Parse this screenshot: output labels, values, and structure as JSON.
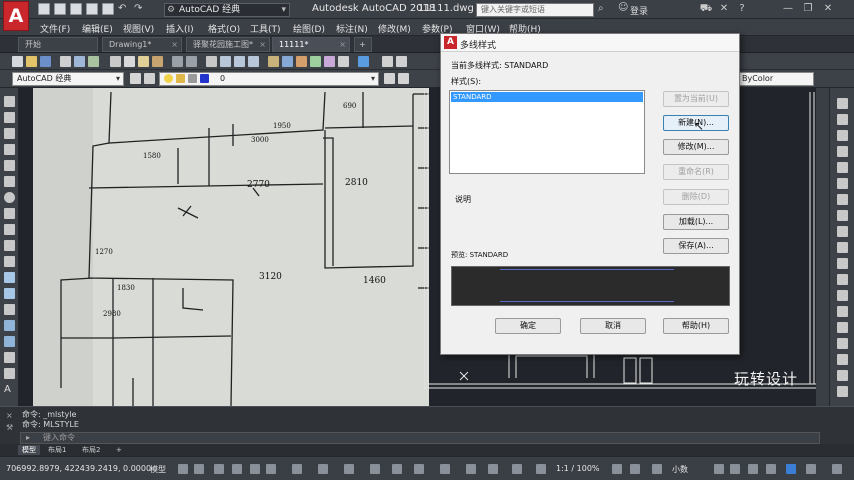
{
  "app": {
    "title": "Autodesk AutoCAD 2018",
    "document": "11111.dwg",
    "workspace": "AutoCAD 经典",
    "search_placeholder": "键入关键字或短语",
    "login": "登录",
    "logo": "A"
  },
  "menu": [
    "文件(F)",
    "编辑(E)",
    "视图(V)",
    "插入(I)",
    "格式(O)",
    "工具(T)",
    "绘图(D)",
    "标注(N)",
    "修改(M)",
    "参数(P)",
    "窗口(W)",
    "帮助(H)"
  ],
  "tabs": [
    {
      "label": "开始",
      "active": false
    },
    {
      "label": "Drawing1*",
      "active": false
    },
    {
      "label": "驿聚花园施工图*",
      "active": false
    },
    {
      "label": "11111*",
      "active": true
    }
  ],
  "toolbar2": {
    "workspace": "AutoCAD 经典",
    "layer_name": "0",
    "bylayer": "ByColor"
  },
  "dialog": {
    "title": "多线样式",
    "current_style": "当前多线样式: STANDARD",
    "styles_label": "样式(S):",
    "styles": [
      "STANDARD"
    ],
    "description_label": "说明",
    "preview_label": "预览: STANDARD",
    "buttons": {
      "set_current": "置为当前(U)",
      "new": "新建(N)...",
      "modify": "修改(M)...",
      "rename": "重命名(R)",
      "delete": "删除(D)",
      "load": "加载(L)...",
      "save": "保存(A)...",
      "ok": "确定",
      "cancel": "取消",
      "help": "帮助(H)"
    }
  },
  "watermark": "玩转设计",
  "command": {
    "history": [
      "命令: _mlstyle",
      "命令: MLSTYLE"
    ],
    "input_placeholder": "键入命令"
  },
  "layout_tabs": [
    {
      "label": "模型",
      "active": true
    },
    {
      "label": "布局1",
      "active": false
    },
    {
      "label": "布局2",
      "active": false
    }
  ],
  "status": {
    "coordinates": "706992.8979, 422439.2419, 0.0000",
    "model": "模型",
    "scale": "1:1 / 100%",
    "annotation": "小数"
  },
  "sketch_labels": [
    "2770",
    "2810",
    "3120",
    "1460",
    "3000",
    "1580",
    "1950",
    "1270",
    "2980",
    "690",
    "1830"
  ]
}
